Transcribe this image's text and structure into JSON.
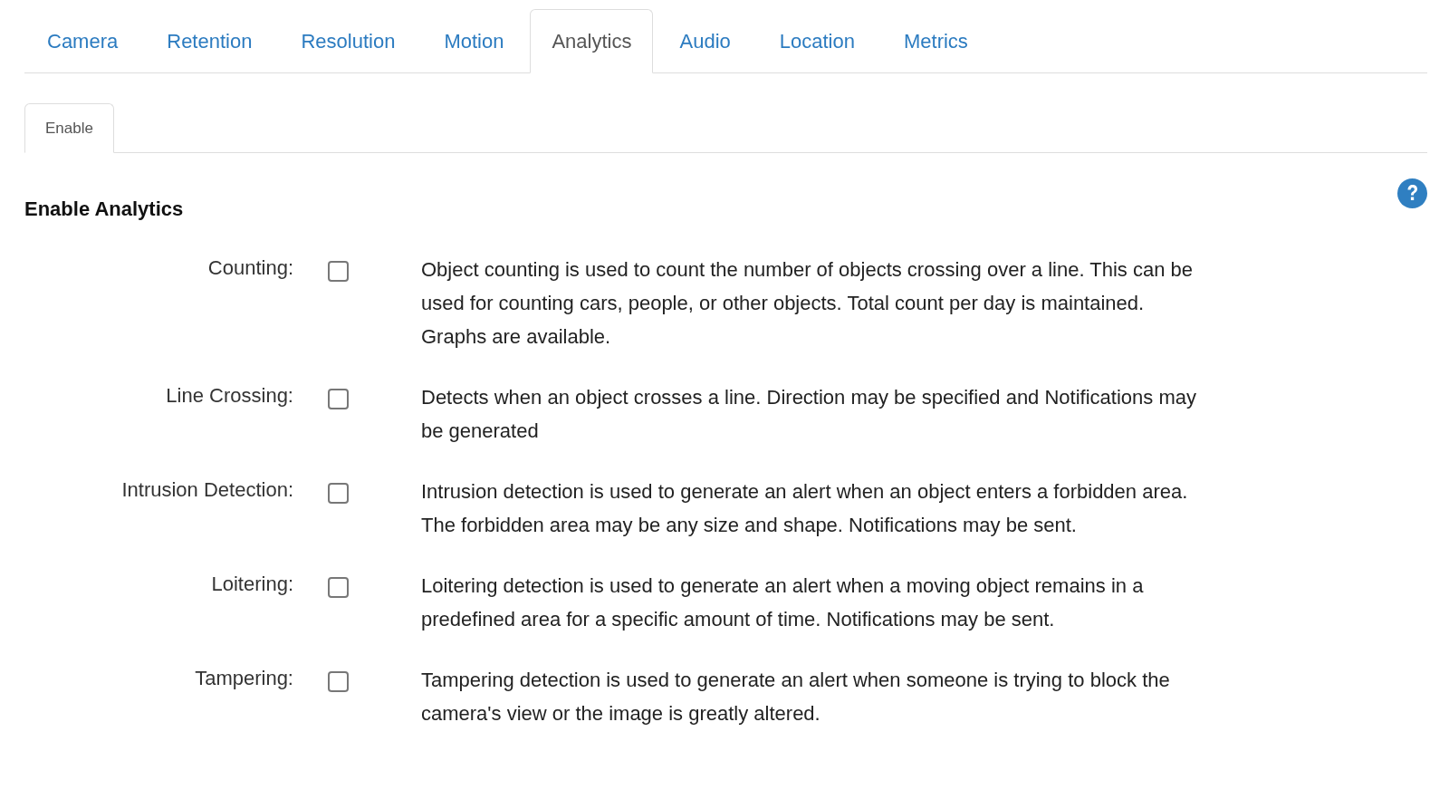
{
  "tabs": [
    {
      "label": "Camera",
      "selected": false
    },
    {
      "label": "Retention",
      "selected": false
    },
    {
      "label": "Resolution",
      "selected": false
    },
    {
      "label": "Motion",
      "selected": false
    },
    {
      "label": "Analytics",
      "selected": true
    },
    {
      "label": "Audio",
      "selected": false
    },
    {
      "label": "Location",
      "selected": false
    },
    {
      "label": "Metrics",
      "selected": false
    }
  ],
  "subtabs": [
    {
      "label": "Enable",
      "selected": true
    }
  ],
  "section": {
    "title": "Enable Analytics"
  },
  "options": [
    {
      "label": "Counting:",
      "checked": false,
      "description": "Object counting is used to count the number of objects crossing over a line. This can be used for counting cars, people, or other objects. Total count per day is maintained. Graphs are available."
    },
    {
      "label": "Line Crossing:",
      "checked": false,
      "description": "Detects when an object crosses a line. Direction may be specified and Notifications may be generated"
    },
    {
      "label": "Intrusion Detection:",
      "checked": false,
      "description": "Intrusion detection is used to generate an alert when an object enters a forbidden area. The forbidden area may be any size and shape. Notifications may be sent."
    },
    {
      "label": "Loitering:",
      "checked": false,
      "description": "Loitering detection is used to generate an alert when a moving object remains in a predefined area for a specific amount of time. Notifications may be sent."
    },
    {
      "label": "Tampering:",
      "checked": false,
      "description": "Tampering detection is used to generate an alert when someone is trying to block the camera's view or the image is greatly altered."
    }
  ]
}
